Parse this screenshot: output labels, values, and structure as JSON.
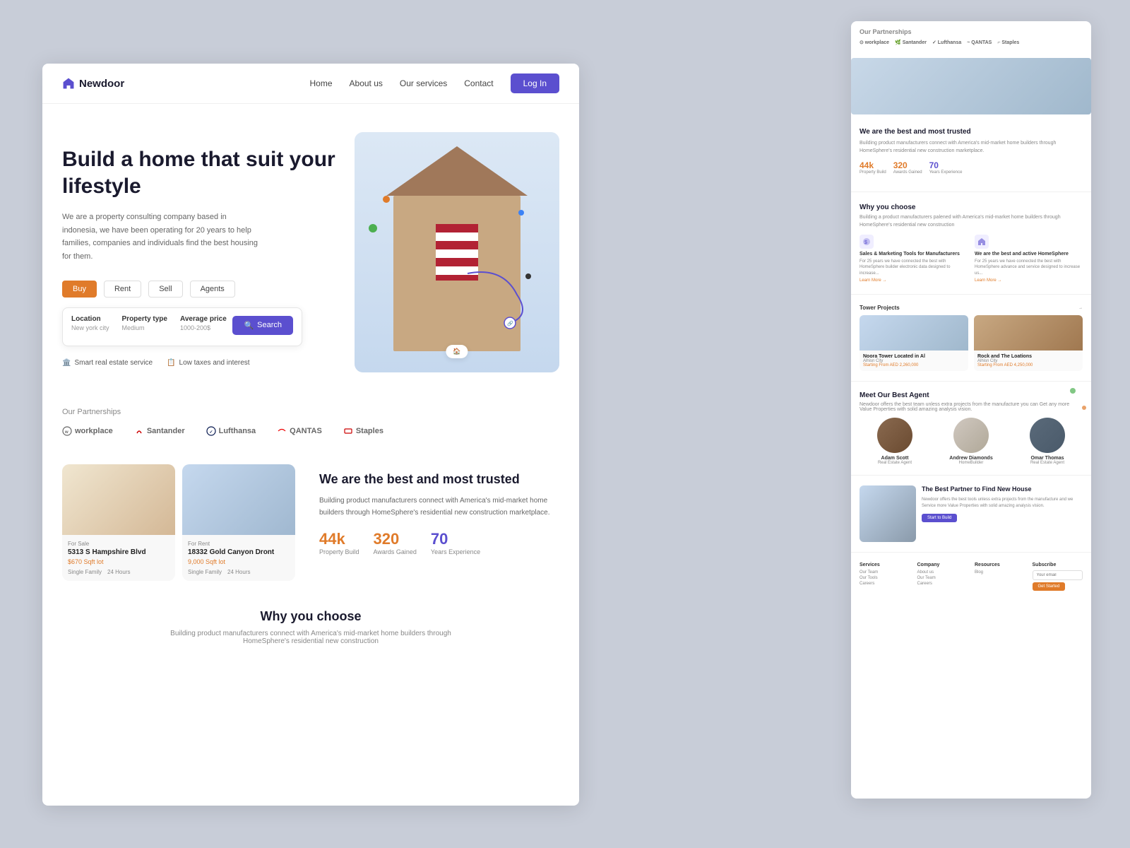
{
  "app": {
    "title": "Newdoor",
    "logo_icon": "🏠"
  },
  "nav": {
    "links": [
      "Home",
      "About us",
      "Our services",
      "Contact"
    ],
    "login_label": "Log In"
  },
  "hero": {
    "title": "Build a home that suit your lifestyle",
    "description": "We are a property consulting company based in indonesia, we have been operating for 20 years to help families, companies and individuals find the best housing for them.",
    "tabs": [
      "Buy",
      "Rent",
      "Sell",
      "Agents"
    ],
    "active_tab": "Buy",
    "search": {
      "location_label": "Location",
      "location_value": "New york city",
      "property_type_label": "Property type",
      "property_type_value": "Medium",
      "avg_price_label": "Average price",
      "avg_price_value": "1000-200$",
      "search_button": "Search"
    },
    "badges": [
      "Smart real estate service",
      "Low taxes and interest"
    ]
  },
  "partnerships": {
    "label": "Our Partnerships",
    "logos": [
      "workplace",
      "Santander",
      "Lufthansa",
      "QANTAS",
      "Staples"
    ]
  },
  "trusted": {
    "title": "We are the best and most trusted",
    "description": "Building product manufacturers connect with America's mid-market home builders through HomeSphere's residential new construction marketplace.",
    "stats": [
      {
        "value": "44k",
        "label": "Property Build",
        "color": "orange"
      },
      {
        "value": "320",
        "label": "Awards Gained",
        "color": "orange"
      },
      {
        "value": "70",
        "label": "Years Experience",
        "color": "blue"
      }
    ],
    "properties": [
      {
        "tag": "For Sale",
        "name": "5313 S Hampshire Blvd",
        "price": "$670 Sqft lot",
        "type": "Single Family",
        "hours": "24 Hours",
        "image_type": "living"
      },
      {
        "tag": "For Rent",
        "name": "18332 Gold Canyon Dront",
        "price": "9,000 Sqft lot",
        "type": "Single Family",
        "hours": "24 Hours",
        "image_type": "exterior"
      }
    ]
  },
  "why_choose": {
    "title": "Why you choose",
    "description": "Building product manufacturers connect with America's mid-market home builders through HomeSphere's residential new construction"
  },
  "back_page": {
    "partnerships_label": "Our Partnerships",
    "partner_logos": [
      "workplace",
      "Santander",
      "Lufthansa",
      "QANTAS",
      "Staples"
    ],
    "trusted_title": "We are the best and most trusted",
    "trusted_desc": "Building product manufacturers connect with America's mid-market home builders through HomeSphere's residential new construction marketplace.",
    "stats": [
      {
        "value": "44k",
        "label": "Property Build"
      },
      {
        "value": "320",
        "label": "Awards Gained"
      },
      {
        "value": "70",
        "label": "Years Experience"
      }
    ],
    "why_title": "Why you choose",
    "why_desc": "Building a product manufacturers palened with America's mid-market home builders through HomeSphere's residential new construction",
    "features": [
      {
        "title": "Sales & Marketing Tools for Manufacturers",
        "desc": "For 25 years we have connected the best with HomeSphere builder electronic data designed to increase..."
      },
      {
        "title": "We are the best and active HomeSphere",
        "desc": "For 25 years we have connected the best with HomeSphere advance and service designed to increase us..."
      }
    ],
    "properties": [
      {
        "name": "Noora Tower Located in Al",
        "location": "Alhisn city",
        "price": "AED 2,260,000",
        "image_type": "apt"
      },
      {
        "name": "Rock and The Loations",
        "location": "Alhisn city",
        "price": "AED 4,250,000",
        "image_type": "house"
      }
    ],
    "meet_agent": {
      "title": "Meet Our Best Agent",
      "desc": "Newdoor offers the best team unless extra projects from the manufacture you can Get any more Value Properties with solid amazing analysis vision.",
      "agents": [
        {
          "name": "Adam Scott",
          "role": "Real Estate Agent"
        },
        {
          "name": "Andrew Diamonds",
          "role": "HomeBuilder"
        },
        {
          "name": "Omar Thomas",
          "role": "Real Estate Agent"
        }
      ]
    },
    "cta": {
      "title": "The Best Partner to Find New House",
      "desc": "Newdoor offers the best tools unless extra projects from the manufacture and we Service more Value Properties with solid amazing analysis vision.",
      "button": "Start to Build"
    },
    "footer": {
      "columns": [
        {
          "title": "Services",
          "items": [
            "Our Team",
            "Our Tools",
            "Careers"
          ]
        },
        {
          "title": "Company",
          "items": [
            "About us",
            "Our Team",
            "Careers"
          ]
        },
        {
          "title": "Resources",
          "items": [
            "Blog"
          ]
        }
      ],
      "subscribe_label": "Subscribe",
      "subscribe_placeholder": "Your email",
      "subscribe_button": "Get Started"
    }
  }
}
